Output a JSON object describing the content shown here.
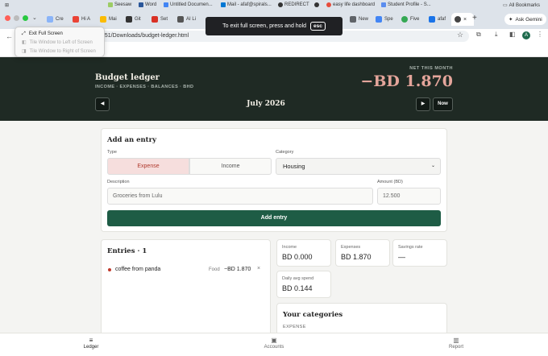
{
  "browser": {
    "tabs": [
      {
        "label": "Cre",
        "color": "#8ab4f8"
      },
      {
        "label": "Hi A",
        "color": "#ea4335"
      },
      {
        "label": "Mai",
        "color": "#fbbc04"
      },
      {
        "label": "Git",
        "color": "#333333"
      },
      {
        "label": "Set",
        "color": "#d93025"
      },
      {
        "label": "AI Li",
        "color": "#555555"
      },
      {
        "label": "New",
        "color": "#5f6368"
      },
      {
        "label": "Spe",
        "color": "#4285f4"
      },
      {
        "label": "Five",
        "color": "#34a853"
      },
      {
        "label": "afaf",
        "color": "#1a73e8"
      },
      {
        "label": "",
        "color": "#444444"
      }
    ],
    "ask_gemini": "Ask Gemini",
    "url": "551/Downloads/budget-ledger.html",
    "bookmarks": [
      "Seesaw",
      "Word",
      "Untitled Documen...",
      "Mail - afaf@spirals...",
      "REDIRECT",
      "",
      "easy life dashboard",
      "Student Profile - S..."
    ],
    "all_bookmarks": "All Bookmarks",
    "avatar_letter": "A"
  },
  "window_menu": {
    "items": [
      {
        "label": "Exit Full Screen",
        "enabled": true
      },
      {
        "label": "Tile Window to Left of Screen",
        "enabled": false
      },
      {
        "label": "Tile Window to Right of Screen",
        "enabled": false
      }
    ]
  },
  "fullscreen_banner": {
    "text": "To exit full screen, press and hold",
    "key": "esc"
  },
  "header": {
    "title": "Budget ledger",
    "subtitle": "INCOME · EXPENSES · BALANCES · BHD",
    "net_label": "NET THIS MONTH",
    "net_value": "−BD 1.870",
    "month": "July 2026",
    "prev": "◀",
    "next": "▶",
    "now": "Now"
  },
  "entry_form": {
    "title": "Add an entry",
    "type_label": "Type",
    "expense": "Expense",
    "income": "Income",
    "category_label": "Category",
    "category_value": "Housing",
    "description_label": "Description",
    "description_placeholder": "Groceries from Lulu",
    "amount_label": "Amount (BD)",
    "amount_placeholder": "12.500",
    "submit": "Add entry"
  },
  "entries": {
    "title": "Entries · 1",
    "items": [
      {
        "description": "coffee from panda",
        "category": "Food",
        "amount": "−BD 1.870",
        "delete": "×"
      }
    ]
  },
  "stats": {
    "income_label": "Income",
    "income": "BD 0.000",
    "expenses_label": "Expenses",
    "expenses": "BD 1.870",
    "savings_label": "Savings rate",
    "savings": "—",
    "daily_label": "Daily avg spend",
    "daily": "BD 0.144"
  },
  "categories": {
    "title": "Your categories",
    "section": "EXPENSE"
  },
  "bottom_nav": {
    "ledger": "Ledger",
    "accounts": "Accounts",
    "report": "Report"
  },
  "colors": {
    "header_bg": "#1f2a24",
    "accent": "#1e5c45",
    "negative": "#e4a59b",
    "expense_dot": "#c0392b"
  }
}
